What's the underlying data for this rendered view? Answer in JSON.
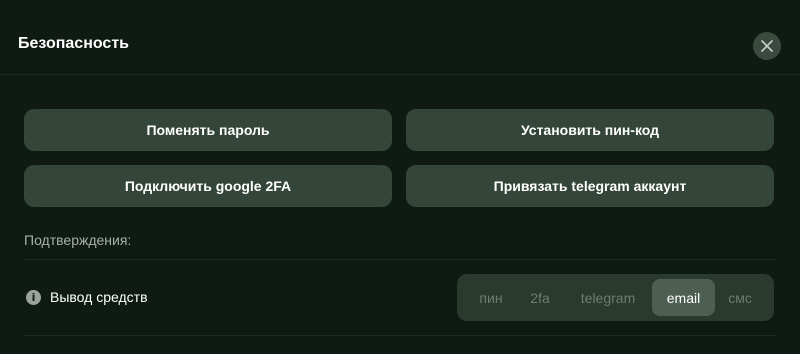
{
  "modal": {
    "title": "Безопасность",
    "close_icon": "close-icon"
  },
  "actions": {
    "change_password": "Поменять пароль",
    "set_pin": "Установить пин-код",
    "connect_google_2fa": "Подключить google 2FA",
    "link_telegram": "Привязать telegram аккаунт"
  },
  "confirmations": {
    "label": "Подтверждения:",
    "rows": [
      {
        "icon": "info-icon",
        "label": "Вывод средств",
        "options": [
          "пин",
          "2fa",
          "telegram",
          "email",
          "смс"
        ],
        "selected": "email"
      }
    ]
  },
  "colors": {
    "background": "#0f1a12",
    "button": "#34453a",
    "segment_bg": "#2a3a2e",
    "segment_active": "#4d5e52"
  }
}
